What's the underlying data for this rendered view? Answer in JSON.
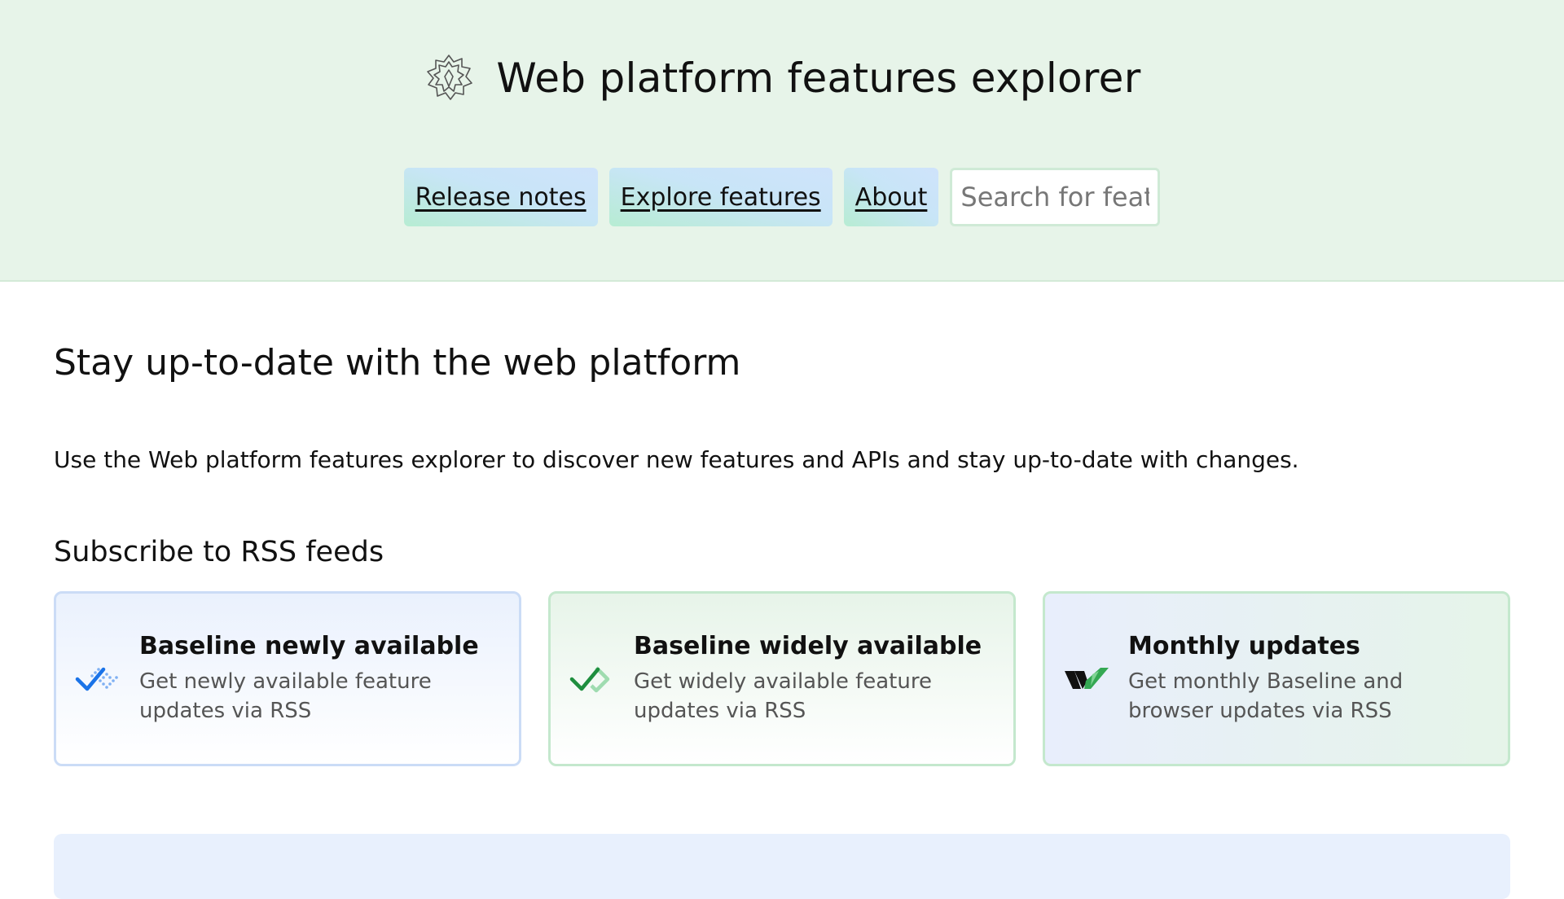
{
  "header": {
    "title": "Web platform features explorer",
    "logo_icon": "baseline-logo-icon",
    "nav": [
      {
        "label": "Release notes"
      },
      {
        "label": "Explore features"
      },
      {
        "label": "About"
      }
    ],
    "search": {
      "placeholder": "Search for features",
      "value": ""
    }
  },
  "main": {
    "title": "Stay up-to-date with the web platform",
    "intro": "Use the Web platform features explorer to discover new features and APIs and stay up-to-date with changes.",
    "rss_title": "Subscribe to RSS feeds",
    "cards": [
      {
        "title": "Baseline newly available",
        "description": "Get newly available feature updates via RSS",
        "icon": "baseline-newly-check-icon"
      },
      {
        "title": "Baseline widely available",
        "description": "Get widely available feature updates via RSS",
        "icon": "baseline-widely-check-icon"
      },
      {
        "title": "Monthly updates",
        "description": "Get monthly Baseline and browser updates via RSS",
        "icon": "monthly-updates-icon"
      }
    ]
  },
  "colors": {
    "header_bg": "#e7f4e9",
    "newly_blue": "#1a73e8",
    "widely_green": "#1e8e3e"
  }
}
